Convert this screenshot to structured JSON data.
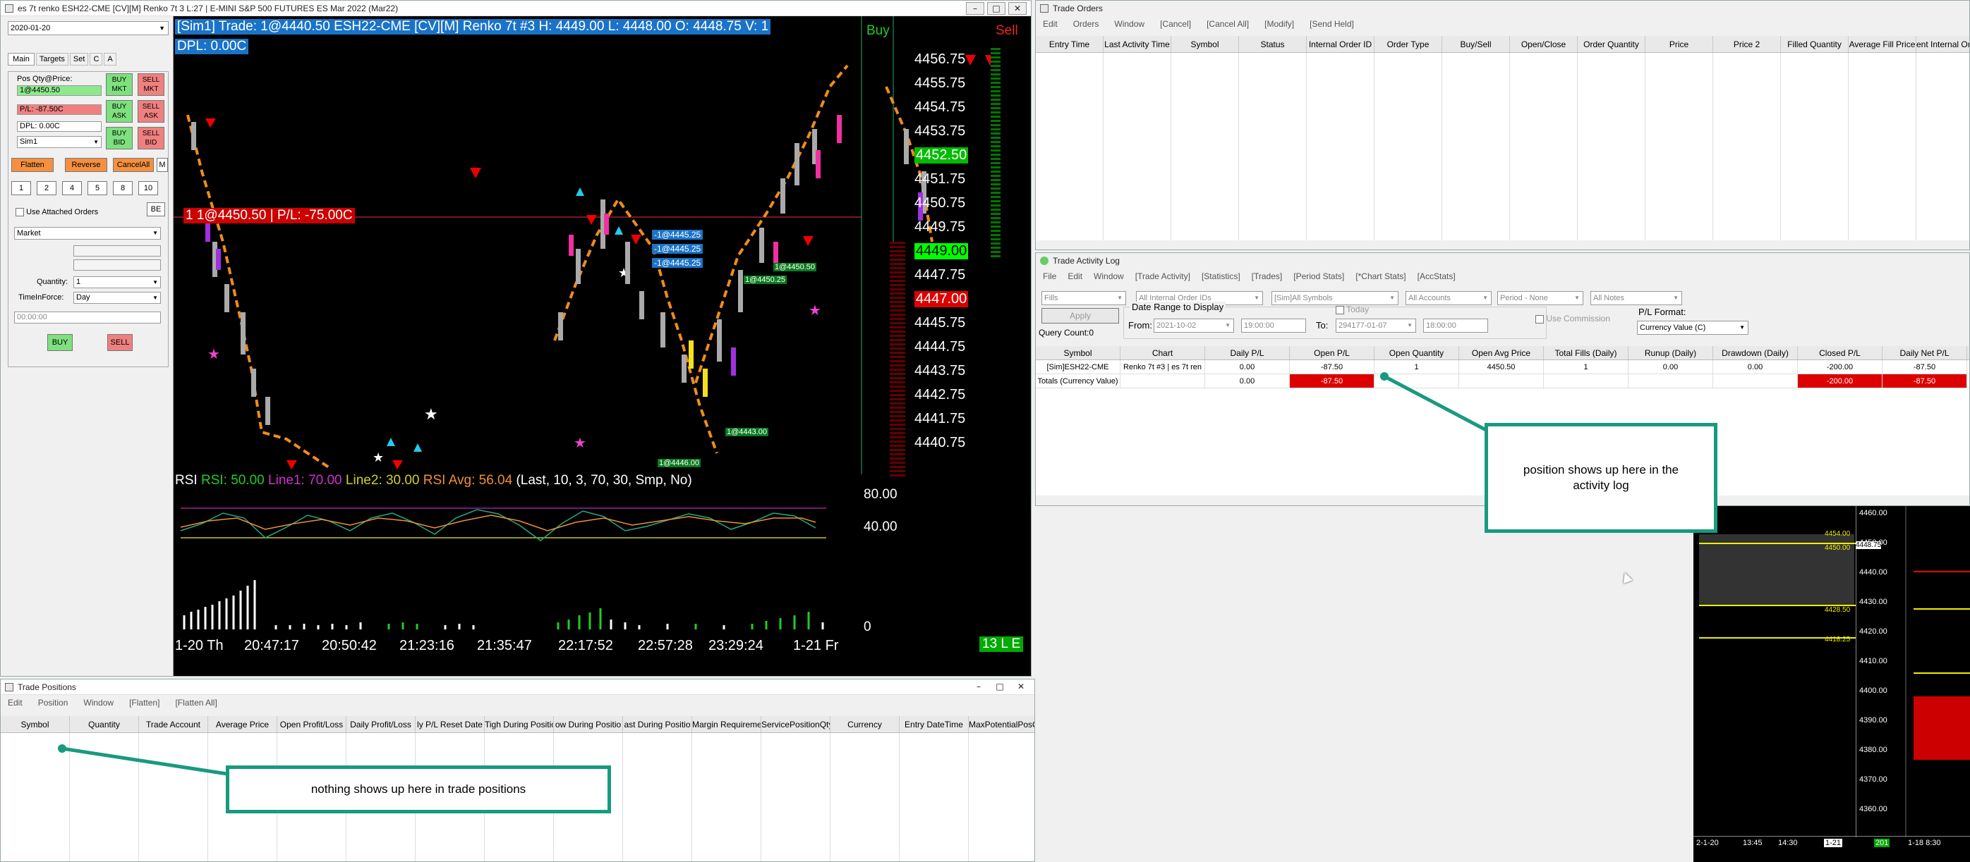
{
  "chart_window": {
    "title": "es 7t renko ESH22-CME [CV][M]  Renko 7t 3 L:27 | E-MINI S&P 500 FUTURES ES Mar 2022 (Mar22)",
    "header_text": "[Sim1]  Trade: 1@4440.50  ESH22-CME [CV][M]  Renko 7t  #3  H: 4449.00  L: 4448.00  O: 4448.75  V: 1",
    "dpl": "DPL: 0.00C",
    "buy_label": "Buy",
    "sell_label": "Sell",
    "price_ticks": [
      "4456.75",
      "4455.75",
      "4454.75",
      "4453.75",
      "4452.50",
      "4451.75",
      "4450.75",
      "4449.75",
      "4449.00",
      "4447.75",
      "4447.00",
      "4445.75",
      "4444.75",
      "4443.75",
      "4442.75",
      "4441.75",
      "4440.75"
    ],
    "highlight_green": "4452.50",
    "last_price": "4449.00",
    "highlight_red": "4447.00",
    "position_label": "1 1@4450.50 | P/L: -75.00C",
    "order_tags": [
      "-1@4445.25",
      "-1@4445.25",
      "-1@4445.25"
    ],
    "fill_tags": [
      "1@4450.50",
      "1@4450.25",
      "1@4443.00",
      "1@4446.00"
    ],
    "rsi_header": {
      "name": "RSI",
      "rsi": "RSI: 50.00",
      "line1": "Line1: 70.00",
      "line2": "Line2: 30.00",
      "avg": "RSI Avg: 56.04",
      "params": "(Last, 10, 3, 70, 30, Smp, No)"
    },
    "rsi_ticks": [
      "80.00",
      "40.00"
    ],
    "vol_tick": "0",
    "time_labels": [
      "1-20 Th",
      "20:47:17",
      "20:50:42",
      "21:23:16",
      "21:35:47",
      "22:17:52",
      "22:57:28",
      "23:29:24",
      "1-21 Fr"
    ],
    "status_label": "13 L E"
  },
  "chart_trader": {
    "date": "2020-01-20",
    "tabs": [
      "Main",
      "Targets",
      "Set",
      "C",
      "A"
    ],
    "pos_label": "Pos Qty@Price:",
    "pos_value": "1@4450.50",
    "pl_value": "P/L: -87.50C",
    "dpl_value": "DPL: 0.00C",
    "account": "Sim1",
    "buy_mkt": "BUY MKT",
    "sell_mkt": "SELL MKT",
    "buy_ask": "BUY ASK",
    "sell_ask": "SELL ASK",
    "buy_bid": "BUY BID",
    "sell_bid": "SELL BID",
    "flatten": "Flatten",
    "reverse": "Reverse",
    "cancel_all": "CancelAll",
    "m": "M",
    "qty_buttons": [
      "1",
      "2",
      "4",
      "5",
      "8",
      "10"
    ],
    "be": "BE",
    "use_attached": "Use Attached Orders",
    "order_type": "Market",
    "quantity_label": "Quantity:",
    "quantity": "1",
    "tif_label": "TimeInForce:",
    "tif": "Day",
    "time": "00:00:00",
    "buy": "BUY",
    "sell": "SELL"
  },
  "trade_orders": {
    "title": "Trade Orders",
    "menu": [
      "Edit",
      "Orders",
      "Window",
      "[Cancel]",
      "[Cancel All]",
      "[Modify]",
      "[Send Held]"
    ],
    "columns": [
      "Entry Time",
      "Last Activity Time",
      "Symbol",
      "Status",
      "Internal Order ID",
      "Order Type",
      "Buy/Sell",
      "Open/Close",
      "Order Quantity",
      "Price",
      "Price 2",
      "Filled Quantity",
      "Average Fill Price",
      "ent Internal Or"
    ]
  },
  "activity_log": {
    "title": "Trade Activity Log",
    "menu": [
      "File",
      "Edit",
      "Window",
      "[Trade Activity]",
      "[Statistics]",
      "[Trades]",
      "[Period Stats]",
      "[*Chart Stats]",
      "[AccStats]"
    ],
    "fills": "Fills",
    "order_ids": "All Internal Order IDs",
    "symbols": "[Sim]All Symbols",
    "accounts": "All Accounts",
    "period": "Period - None",
    "notes": "All Notes",
    "apply": "Apply",
    "query_count": "Query Count:0",
    "date_range": "Date Range to Display",
    "from_label": "From:",
    "from_date": "2021-10-02",
    "from_time": "19:00:00",
    "to_label": "To:",
    "today": "Today",
    "to_date": "294177-01-07",
    "to_time": "18:00:00",
    "use_commission": "Use Commission",
    "pl_format_label": "P/L Format:",
    "pl_format": "Currency Value (C)",
    "columns": [
      "Symbol",
      "Chart",
      "Daily P/L",
      "Open P/L",
      "Open Quantity",
      "Open Avg Price",
      "Total Fills (Daily)",
      "Runup (Daily)",
      "Drawdown (Daily)",
      "Closed P/L",
      "Daily Net P/L"
    ],
    "row1": [
      "[Sim]ESH22-CME",
      "Renko 7t  #3 | es 7t ren",
      "0.00",
      "-87.50",
      "1",
      "4450.50",
      "1",
      "0.00",
      "0.00",
      "-200.00",
      "-87.50"
    ],
    "row2": [
      "Totals (Currency Value)",
      "",
      "0.00",
      "-87.50",
      "",
      "",
      "",
      "",
      "",
      "-200.00",
      "-87.50"
    ]
  },
  "trade_positions": {
    "title": "Trade Positions",
    "menu": [
      "Edit",
      "Position",
      "Window",
      "[Flatten]",
      "[Flatten All]"
    ],
    "columns": [
      "Symbol",
      "Quantity",
      "Trade Account",
      "Average Price",
      "Open Profit/Loss",
      "Daily Profit/Loss",
      "ly P/L Reset Date",
      "Tigh During Positio",
      "ow During Positio",
      "ast During Positio",
      "Margin Requireme",
      "ServicePositionQty",
      "Currency",
      "Entry DateTime",
      "MaxPotentialPosQt"
    ]
  },
  "callouts": {
    "activity": "position shows up here in the activity log",
    "positions": "nothing shows up here in trade positions"
  },
  "mini_chart": {
    "ticks": [
      "4460.00",
      "4450.00",
      "4440.00",
      "4430.00",
      "4420.00",
      "4410.00",
      "4400.00",
      "4390.00",
      "4380.00",
      "4370.00",
      "4360.00"
    ],
    "tags": [
      "4454.00",
      "4450.00",
      "4448.75",
      "4428.50",
      "4418.25"
    ],
    "times": [
      "2-1-20",
      "13:45",
      "14:30",
      "1-21",
      "201"
    ],
    "right_time": "1-18 8:30"
  }
}
